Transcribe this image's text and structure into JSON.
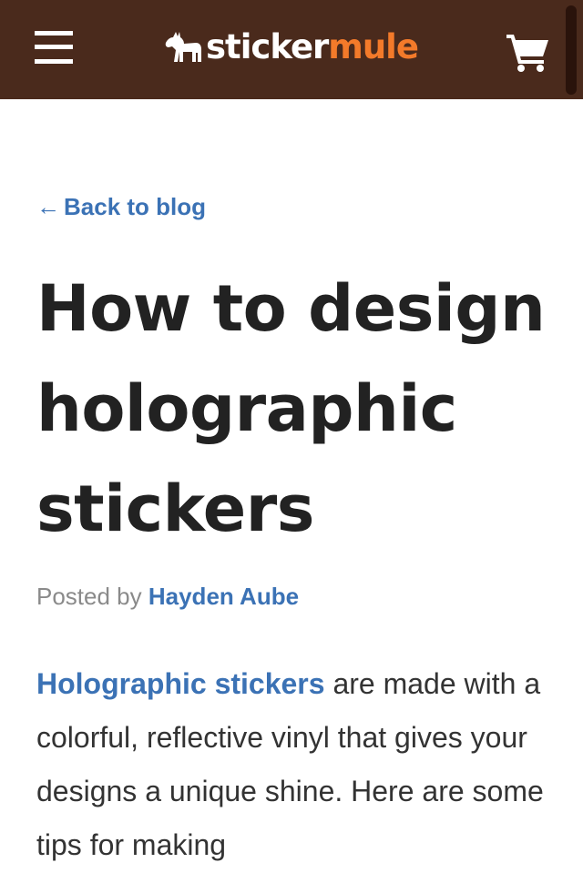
{
  "header": {
    "logo_left": "sticker",
    "logo_right": "mule",
    "colors": {
      "bar": "#4a2a1c",
      "logo_accent": "#f37a2a"
    },
    "icons": [
      "menu-icon",
      "mule-logo-icon",
      "cart-icon"
    ]
  },
  "nav": {
    "back_arrow": "←",
    "back_label": "Back to blog"
  },
  "article": {
    "title": "How to design holographic stickers",
    "byline_prefix": "Posted by ",
    "author": "Hayden Aube",
    "intro_link": "Holographic stickers",
    "intro_rest": " are made with a colorful, reflective vinyl that gives your designs a unique shine. Here are some tips for making"
  },
  "colors": {
    "link": "#3b72b5",
    "title": "#222222",
    "body": "#333333",
    "muted": "#8a8a8a"
  }
}
